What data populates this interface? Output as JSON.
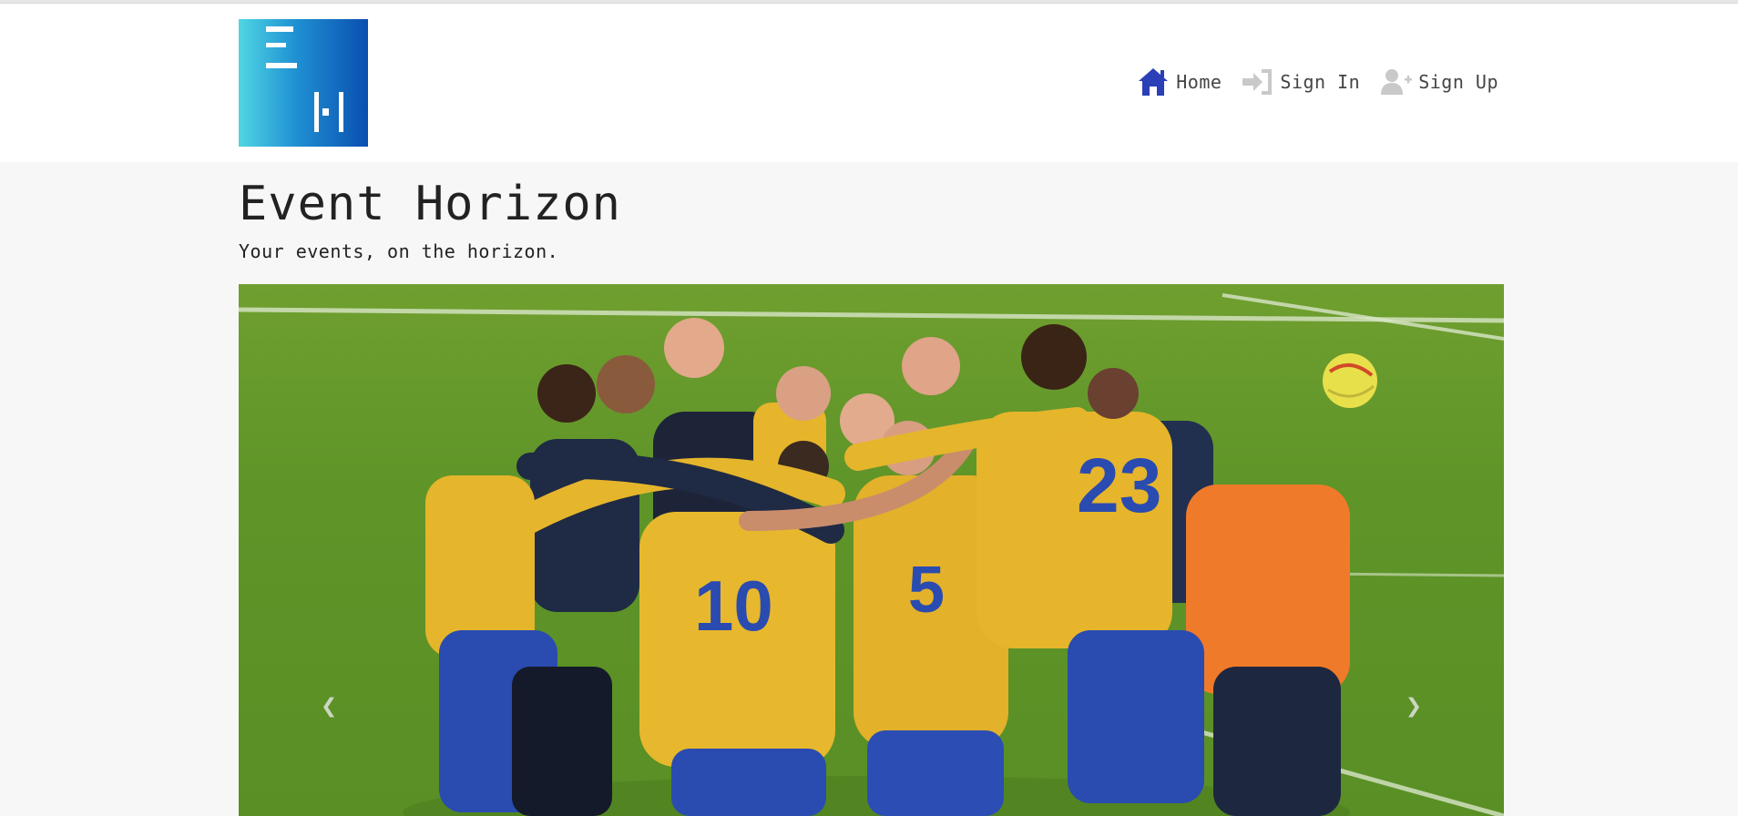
{
  "navbar": {
    "logo_icon": "event-horizon-logo",
    "items": [
      {
        "label": "Home",
        "icon": "home-icon",
        "color": "#2b3fb6"
      },
      {
        "label": "Sign In",
        "icon": "sign-in-icon",
        "color": "#c9c9c9"
      },
      {
        "label": "Sign Up",
        "icon": "user-plus-icon",
        "color": "#c9c9c9"
      }
    ]
  },
  "hero": {
    "title": "Event Horizon",
    "subtitle": "Your events, on the horizon."
  },
  "carousel": {
    "prev_icon": "chevron-left-icon",
    "next_icon": "chevron-right-icon",
    "prev_glyph": "❮",
    "next_glyph": "❯"
  },
  "colors": {
    "brand_blue": "#0a4fb0",
    "brand_cyan": "#4fd6e3",
    "nav_active": "#2b3fb6",
    "nav_inactive": "#c9c9c9"
  }
}
